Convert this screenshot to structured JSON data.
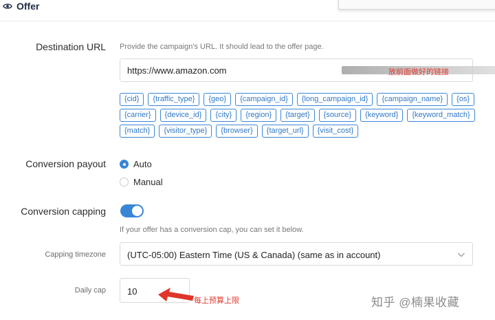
{
  "header": {
    "title": "Offer",
    "icon": "eye-icon"
  },
  "destination": {
    "label": "Destination URL",
    "hint": "Provide the campaign's URL. It should lead to the offer page.",
    "url_value": "https://www.amazon.com",
    "annotation": "放前面做好的链接",
    "tokens": [
      "{cid}",
      "{traffic_type}",
      "{geo}",
      "{campaign_id}",
      "{long_campaign_id}",
      "{campaign_name}",
      "{os}",
      "{carrier}",
      "{device_id}",
      "{city}",
      "{region}",
      "{target}",
      "{source}",
      "{keyword}",
      "{keyword_match}",
      "{match}",
      "{visitor_type}",
      "{browser}",
      "{target_url}",
      "{visit_cost}"
    ]
  },
  "payout": {
    "label": "Conversion payout",
    "options": [
      {
        "label": "Auto",
        "checked": true
      },
      {
        "label": "Manual",
        "checked": false
      }
    ]
  },
  "capping": {
    "label": "Conversion capping",
    "enabled": true,
    "hint": "If your offer has a conversion cap, you can set it below.",
    "timezone_label": "Capping timezone",
    "timezone_value": "(UTC-05:00) Eastern Time (US & Canada) (same as in account)",
    "daily_label": "Daily cap",
    "daily_value": "10",
    "annotation": "每上预算上限"
  },
  "watermark": "知乎 @楠果收藏",
  "colors": {
    "accent": "#3a86d6",
    "annotation": "#e03a2f"
  }
}
